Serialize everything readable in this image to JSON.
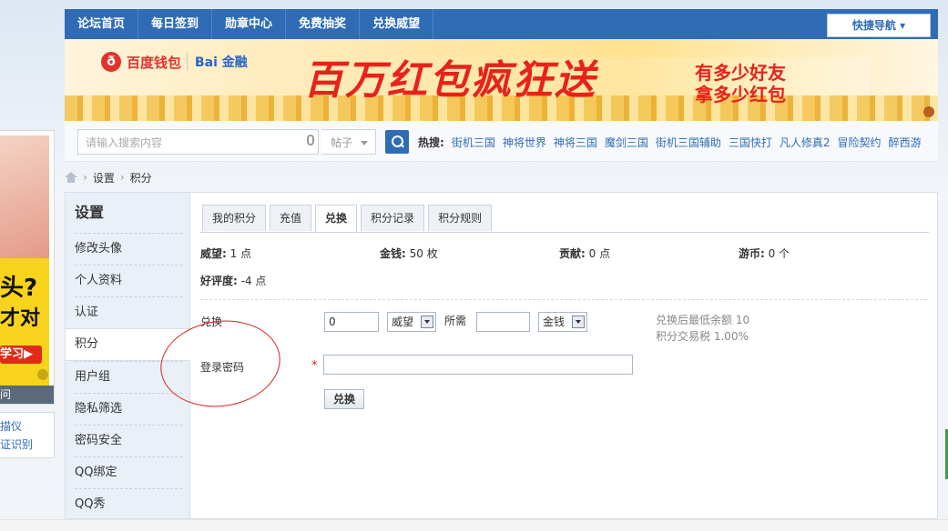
{
  "topnav": {
    "items": [
      "论坛首页",
      "每日签到",
      "勋章中心",
      "免费抽奖",
      "兑换威望"
    ],
    "quick_nav": "快捷导航"
  },
  "banner": {
    "brand_left": "百度钱包",
    "brand_right": "Bai 金融",
    "title": "百万红包疯狂送",
    "sub1": "有多少好友",
    "sub2": "拿多少红包"
  },
  "search": {
    "placeholder": "请输入搜索内容",
    "type_label": "帖子",
    "hot_label": "热搜:",
    "hot_links": [
      "街机三国",
      "神将世界",
      "神将三国",
      "魔剑三国",
      "街机三国辅助",
      "三国快打",
      "凡人修真2",
      "冒险契约",
      "醉西游"
    ]
  },
  "breadcrumb": {
    "items": [
      "设置",
      "积分"
    ]
  },
  "left_ad": {
    "text1": "头?",
    "text2": "才对",
    "button": "学习▶",
    "bottom_bar": "问",
    "link1": "描仪",
    "link2": "证识别"
  },
  "sidebar": {
    "title": "设置",
    "items": [
      "修改头像",
      "个人资料",
      "认证",
      "积分",
      "用户组",
      "隐私筛选",
      "密码安全",
      "QQ绑定",
      "QQ秀"
    ],
    "active_index": 3
  },
  "tabs": [
    "我的积分",
    "充值",
    "兑换",
    "积分记录",
    "积分规则"
  ],
  "active_tab": "兑换",
  "stats": {
    "weiwang": {
      "label": "威望:",
      "value": "1 点"
    },
    "jinqian": {
      "label": "金钱:",
      "value": "50 枚"
    },
    "gongxian": {
      "label": "贡献:",
      "value": "0 点"
    },
    "youbi": {
      "label": "游币:",
      "value": "0 个"
    },
    "haopingdu": {
      "label": "好评度:",
      "value": "-4 点"
    }
  },
  "form": {
    "exchange_label": "兑换",
    "exchange_value": "0",
    "from_select": "威望",
    "needs_label": "所需",
    "needs_value": "",
    "to_select": "金钱",
    "hint1": "兑换后最低余额 10",
    "hint2": "积分交易税 1.00%",
    "password_label": "登录密码",
    "required_mark": "*",
    "password_value": "",
    "submit": "兑换"
  },
  "colors": {
    "primary": "#2f6cb5",
    "accent_red": "#e8221a",
    "annotation": "#e02020"
  }
}
